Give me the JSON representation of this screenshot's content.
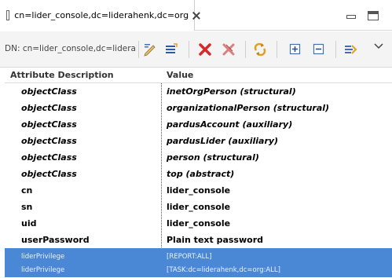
{
  "tab": {
    "title": "cn=lider_console,dc=liderahenk,dc=org"
  },
  "toolbar": {
    "dn_label": "DN: cn=lider_console,dc=liderahenk,dc=org",
    "icons": [
      "edit-icon",
      "rename-icon",
      "delete-icon",
      "delete-all-icon",
      "refresh-icon",
      "expand-icon",
      "collapse-icon",
      "navigate-icon",
      "view-menu-icon"
    ]
  },
  "table": {
    "columns": [
      "Attribute Description",
      "Value"
    ],
    "rows": [
      {
        "attr": "objectClass",
        "value": "inetOrgPerson (structural)"
      },
      {
        "attr": "objectClass",
        "value": "organizationalPerson (structural)"
      },
      {
        "attr": "objectClass",
        "value": "pardusAccount (auxiliary)"
      },
      {
        "attr": "objectClass",
        "value": "pardusLider (auxiliary)"
      },
      {
        "attr": "objectClass",
        "value": "person (structural)"
      },
      {
        "attr": "objectClass",
        "value": "top (abstract)"
      },
      {
        "attr": "cn",
        "value": "lider_console"
      },
      {
        "attr": "sn",
        "value": "lider_console"
      },
      {
        "attr": "uid",
        "value": "lider_console"
      },
      {
        "attr": "userPassword",
        "value": "Plain text password"
      },
      {
        "attr": "liderPrivilege",
        "value": "[REPORT:ALL]"
      },
      {
        "attr": "liderPrivilege",
        "value": "[TASK:dc=liderahenk,dc=org:ALL]"
      }
    ]
  },
  "colors": {
    "selection": "#4a88d6",
    "delete_red": "#d62a2a"
  }
}
